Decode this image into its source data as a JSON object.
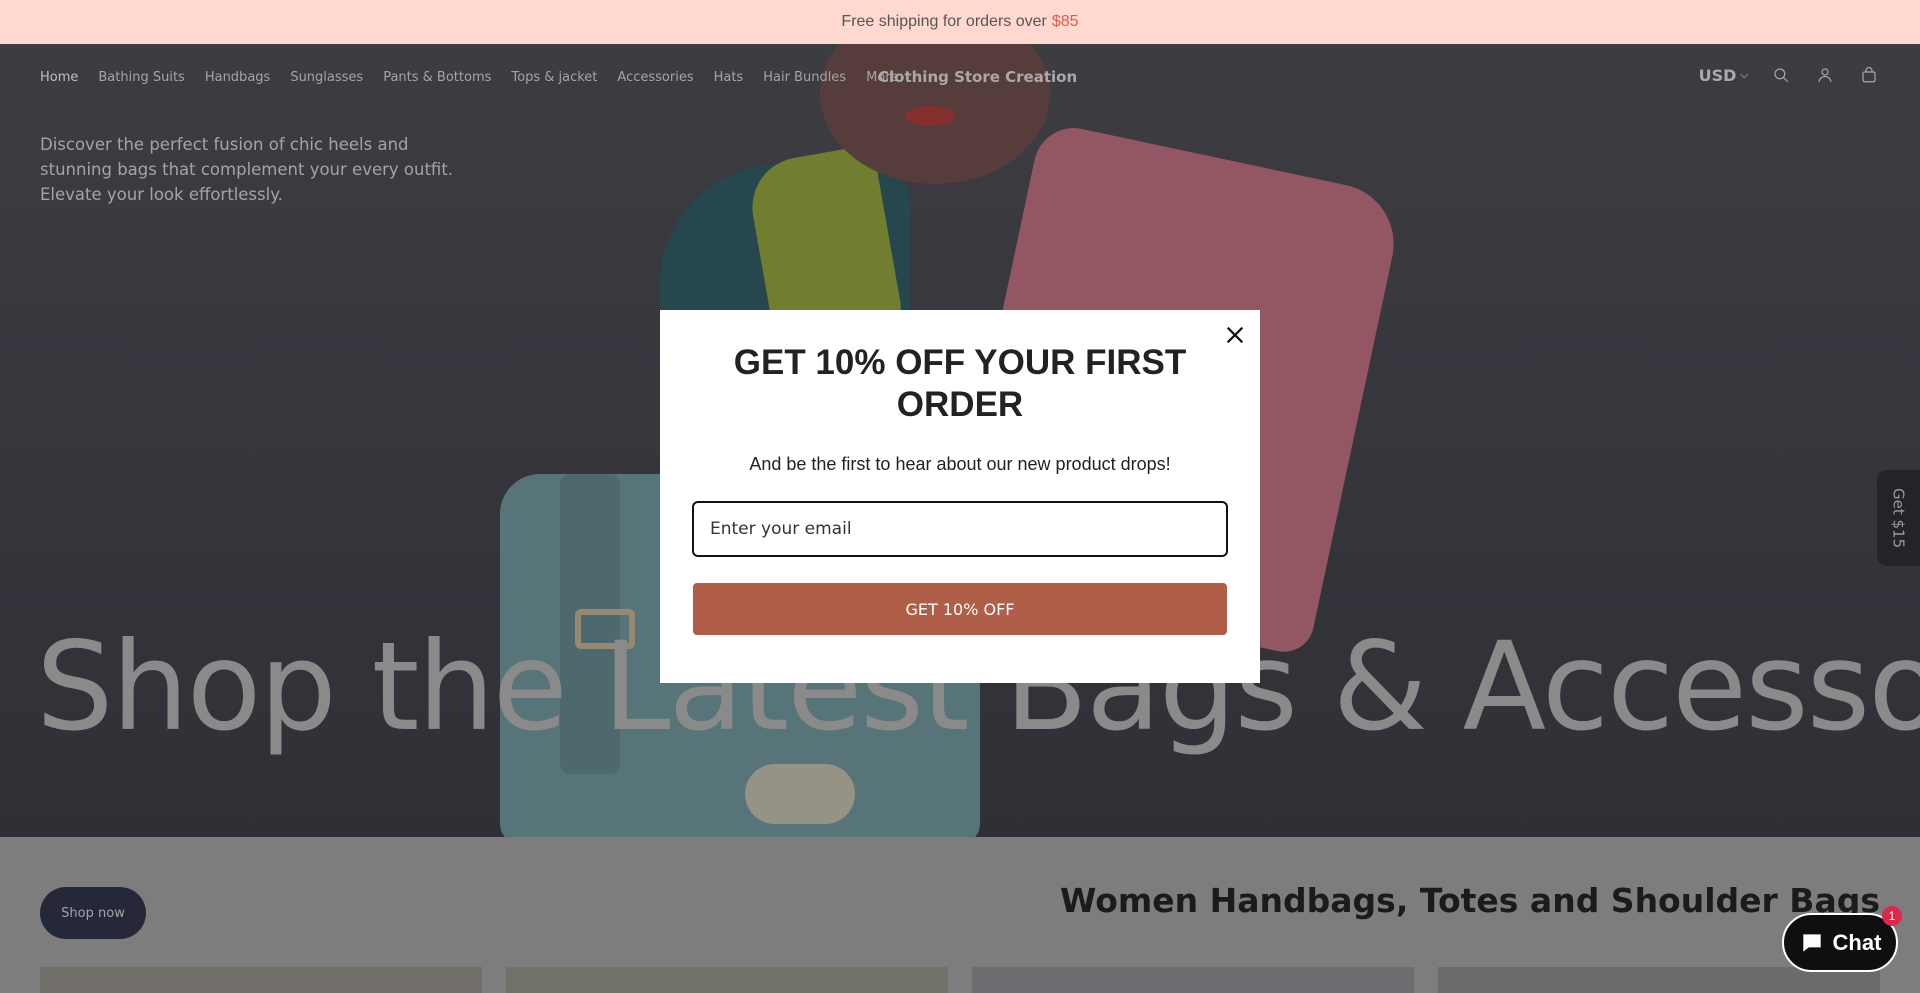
{
  "announcement": {
    "text": "Free shipping for orders over",
    "price": "$85"
  },
  "header": {
    "nav": [
      {
        "label": "Home",
        "active": true
      },
      {
        "label": "Bathing Suits"
      },
      {
        "label": "Handbags"
      },
      {
        "label": "Sunglasses"
      },
      {
        "label": "Pants & Bottoms"
      },
      {
        "label": "Tops & jacket"
      },
      {
        "label": "Accessories"
      },
      {
        "label": "Hats"
      },
      {
        "label": "Hair Bundles"
      },
      {
        "label": "More"
      }
    ],
    "logo": "Clothing Store Creation",
    "currency": "USD",
    "icons": [
      "search-icon",
      "account-icon",
      "cart-icon"
    ]
  },
  "hero": {
    "description": "Discover the perfect fusion of chic heels and stunning bags that complement your every outfit. Elevate your look effortlessly.",
    "heading": "Shop the Latest Bags & Accessories"
  },
  "side_tab": {
    "label": "Get $15"
  },
  "section": {
    "button": "Shop now",
    "title": "Women Handbags, Totes and Shoulder Bags"
  },
  "modal": {
    "title": "GET 10% OFF YOUR FIRST ORDER",
    "subtitle": "And be the first to hear about our new product drops!",
    "email_placeholder": "Enter your email",
    "cta": "GET 10% OFF"
  },
  "chat": {
    "label": "Chat",
    "badge": "1"
  },
  "colors": {
    "announcement_bg": "#ffd9cf",
    "price_accent": "#e05a4a",
    "cta_bg": "#b05e48",
    "shop_now_bg": "#2d3146",
    "chat_badge": "#e0264b"
  }
}
